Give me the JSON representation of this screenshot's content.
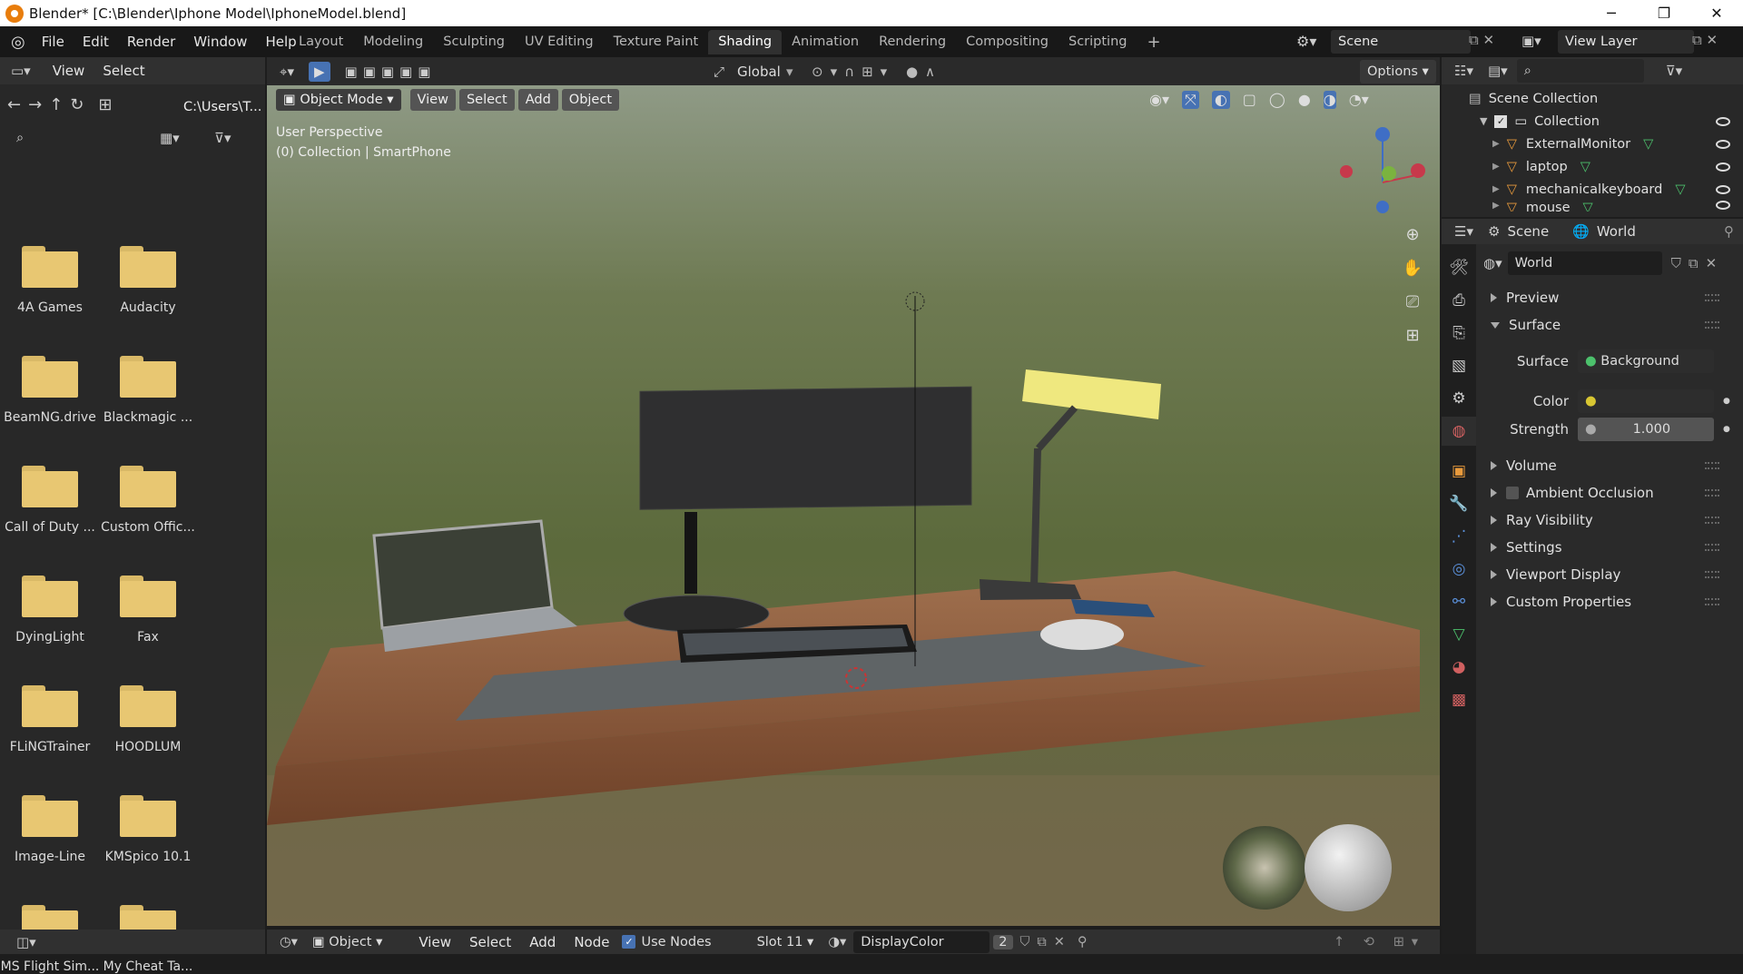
{
  "titlebar": {
    "title": "Blender* [C:\\Blender\\Iphone Model\\IphoneModel.blend]"
  },
  "menu": [
    "File",
    "Edit",
    "Render",
    "Window",
    "Help"
  ],
  "workspaces": [
    "Layout",
    "Modeling",
    "Sculpting",
    "UV Editing",
    "Texture Paint",
    "Shading",
    "Animation",
    "Rendering",
    "Compositing",
    "Scripting"
  ],
  "active_workspace": "Shading",
  "scene": {
    "name": "Scene",
    "view_layer": "View Layer"
  },
  "filebrowser": {
    "header": [
      "View",
      "Select"
    ],
    "path": "C:\\Users\\T...",
    "folders": [
      "4A Games",
      "Audacity",
      "BeamNG.drive",
      "Blackmagic ...",
      "Call of Duty ...",
      "Custom Offic...",
      "DyingLight",
      "Fax",
      "FLiNGTrainer",
      "HOODLUM",
      "Image-Line",
      "KMSpico 10.1",
      "MS Flight Sim...",
      "My Cheat Ta..."
    ]
  },
  "viewport": {
    "transform": "Global",
    "options": "Options",
    "mode": "Object Mode",
    "menu": [
      "View",
      "Select",
      "Add",
      "Object"
    ],
    "perspective": "User Perspective",
    "collection_info": "(0) Collection | SmartPhone",
    "gizmo": {
      "z": "Z",
      "y": "Y",
      "x": "X"
    }
  },
  "outliner": {
    "root": "Scene Collection",
    "collection": "Collection",
    "items": [
      "ExternalMonitor",
      "laptop",
      "mechanicalkeyboard",
      "mouse"
    ]
  },
  "properties": {
    "breadcrumb": [
      "Scene",
      "World"
    ],
    "world_name": "World",
    "panels": {
      "preview": "Preview",
      "surface": "Surface",
      "surface_label": "Surface",
      "surface_value": "Background",
      "color_label": "Color",
      "strength_label": "Strength",
      "strength_value": "1.000",
      "volume": "Volume",
      "ambient_occlusion": "Ambient Occlusion",
      "ray_visibility": "Ray Visibility",
      "settings": "Settings",
      "viewport_display": "Viewport Display",
      "custom_properties": "Custom Properties"
    }
  },
  "footer": {
    "type": "Object",
    "menu": [
      "View",
      "Select",
      "Add",
      "Node"
    ],
    "use_nodes": "Use Nodes",
    "slot": "Slot 11",
    "material": "DisplayColor",
    "users": "2"
  },
  "colors": {
    "accent": "#4772b3",
    "folder": "#e8c772",
    "orange": "#e87d0d",
    "desk": "#8a5a3a"
  }
}
